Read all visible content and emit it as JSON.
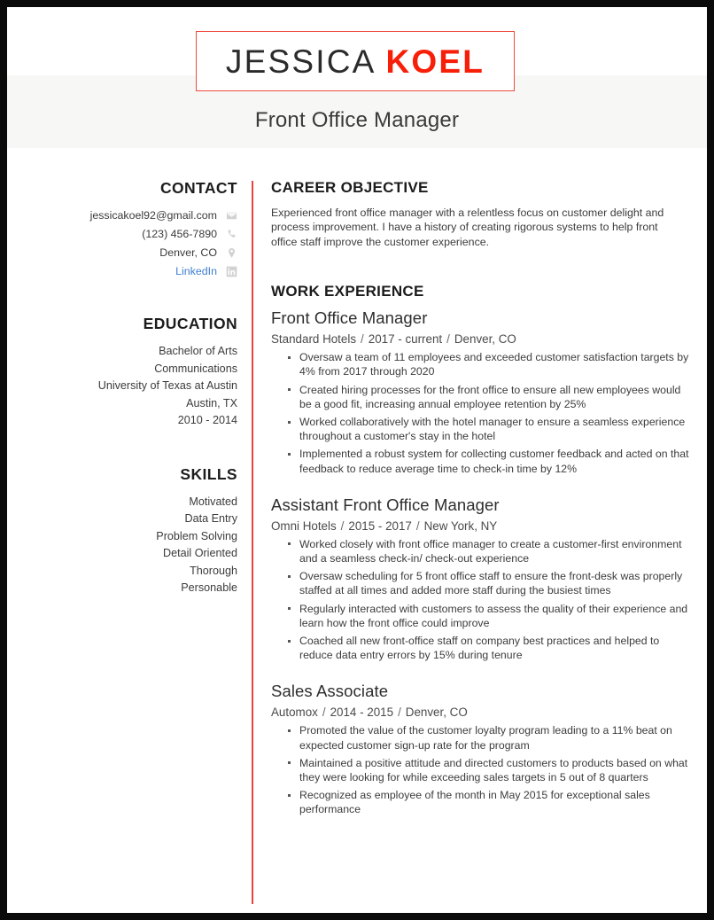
{
  "header": {
    "first_name": "JESSICA",
    "last_name": "KOEL",
    "job_title": "Front Office Manager",
    "accent_color": "#f81f08",
    "box_border_color": "#ee4b3c",
    "band_color": "#f7f7f6"
  },
  "sidebar": {
    "contact": {
      "heading": "CONTACT",
      "items": [
        {
          "text": "jessicakoel92@gmail.com",
          "icon": "envelope-icon",
          "is_link": false
        },
        {
          "text": "(123) 456-7890",
          "icon": "phone-icon",
          "is_link": false
        },
        {
          "text": "Denver, CO",
          "icon": "location-pin-icon",
          "is_link": false
        },
        {
          "text": "LinkedIn",
          "icon": "linkedin-icon",
          "is_link": true
        }
      ],
      "link_color": "#3f7fd0"
    },
    "education": {
      "heading": "EDUCATION",
      "lines": [
        "Bachelor of Arts",
        "Communications",
        "University of Texas at Austin",
        "Austin, TX",
        "2010 - 2014"
      ]
    },
    "skills": {
      "heading": "SKILLS",
      "items": [
        "Motivated",
        "Data Entry",
        "Problem Solving",
        "Detail Oriented",
        "Thorough",
        "Personable"
      ]
    }
  },
  "main": {
    "objective": {
      "heading": "CAREER OBJECTIVE",
      "text": "Experienced front office manager with a relentless focus on customer delight and process improvement. I have a history of creating rigorous systems to help front office staff improve the customer experience."
    },
    "work": {
      "heading": "WORK EXPERIENCE",
      "jobs": [
        {
          "role": "Front Office Manager",
          "company": "Standard Hotels",
          "dates": "2017 - current",
          "location": "Denver, CO",
          "bullets": [
            "Oversaw a team of 11 employees and exceeded customer satisfaction targets by 4% from 2017 through 2020",
            "Created hiring processes for the front office to ensure all new employees would be a good fit, increasing annual employee retention by 25%",
            "Worked collaboratively with the hotel manager to ensure a seamless experience throughout a customer's stay in the hotel",
            "Implemented a robust system for collecting customer feedback and acted on that feedback to reduce average time to check-in time by 12%"
          ]
        },
        {
          "role": "Assistant Front Office Manager",
          "company": "Omni Hotels",
          "dates": "2015 - 2017",
          "location": "New York, NY",
          "bullets": [
            "Worked closely with front office manager to create a customer-first environment and a seamless check-in/ check-out experience",
            "Oversaw scheduling for 5 front office staff to ensure the front-desk was properly staffed at all times and added more staff during the busiest times",
            "Regularly interacted with customers to assess the quality of their experience and learn how the front office could improve",
            "Coached all new front-office staff on company best practices and helped to reduce data entry errors by 15% during tenure"
          ]
        },
        {
          "role": "Sales Associate",
          "company": "Automox",
          "dates": "2014 - 2015",
          "location": "Denver, CO",
          "bullets": [
            "Promoted the value of the customer loyalty program leading to a 11% beat on expected customer sign-up rate for the program",
            "Maintained a positive attitude and directed customers to products based on what they were looking for while exceeding sales targets in 5 out of 8 quarters",
            "Recognized as employee of the month in May 2015 for exceptional sales performance"
          ]
        }
      ],
      "separator": "/"
    }
  }
}
